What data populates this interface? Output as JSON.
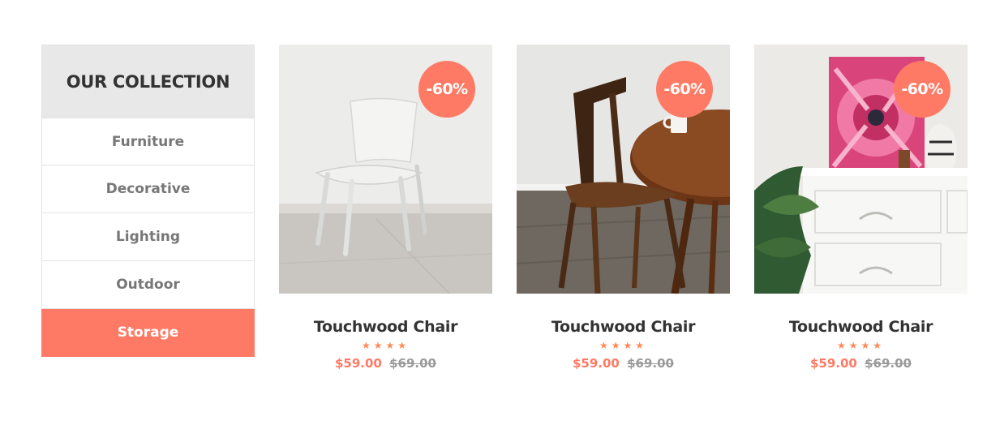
{
  "sidebar": {
    "title": "OUR COLLECTION",
    "categories": [
      {
        "label": "Furniture"
      },
      {
        "label": "Decorative"
      },
      {
        "label": "Lighting"
      },
      {
        "label": "Outdoor"
      },
      {
        "label": "Storage"
      }
    ],
    "active_category": "Storage"
  },
  "products": [
    {
      "title": "Touchwood Chair",
      "badge": "-60%",
      "stars": "★★★★",
      "rating": 4,
      "price": "$59.00",
      "old_price": "$69.00",
      "image": "white-plastic-chair"
    },
    {
      "title": "Touchwood Chair",
      "badge": "-60%",
      "stars": "★★★★",
      "rating": 4,
      "price": "$59.00",
      "old_price": "$69.00",
      "image": "wooden-chair-and-round-table"
    },
    {
      "title": "Touchwood Chair",
      "badge": "-60%",
      "stars": "★★★★",
      "rating": 4,
      "price": "$59.00",
      "old_price": "$69.00",
      "image": "white-dresser-with-pink-painting"
    }
  ],
  "colors": {
    "accent": "#ff7a65",
    "stars": "#ff8b57",
    "sidebar_header_bg": "#e8e8e8",
    "title_text": "#333333",
    "muted_text": "#777777"
  }
}
